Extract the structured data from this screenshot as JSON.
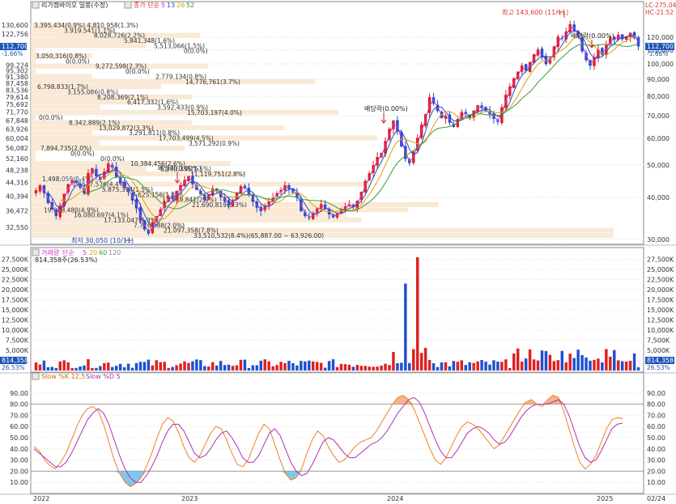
{
  "price_panel": {
    "legend_title": "리가켐바이오 일봉(수정)",
    "legend_ma_label": "종가 단순",
    "ma_periods": [
      "5",
      "13",
      "26",
      "52"
    ],
    "ma_colors": [
      "#cc33cc",
      "#1c50c8",
      "#e0a000",
      "#3a9a3a"
    ],
    "lc_label": "LC-275.04",
    "hc_label": "HC-21.52",
    "left_tag": "112,700",
    "left_tag_pct": "-1.66%",
    "right_tag": "112,700",
    "right_tag_pct": "-1.66%",
    "high_label": "최고 143,600 (11/11)",
    "low_label": "최저 30,050 (10/11)",
    "left_ticks": [
      "130,600",
      "122,756",
      "112,700",
      "99,224",
      "95,302",
      "91,380",
      "87,458",
      "83,536",
      "79,614",
      "75,692",
      "71,770",
      "67,848",
      "63,926",
      "60,004",
      "56,082",
      "52,160",
      "48,238",
      "44,316",
      "40,394",
      "36,472",
      "32,550"
    ],
    "right_ticks": [
      "120,000",
      "110,000",
      "100,000",
      "90,000",
      "80,000",
      "70,000",
      "60,000",
      "50,000",
      "40,000",
      "30,000"
    ],
    "dividend_labels": [
      "배당락(0.00%)",
      "배당락(0.00%)",
      "배당락(0.00%)"
    ],
    "volume_profile": [
      {
        "price": "3,395,434(0.9%)",
        "pct": "1.3%",
        "text": "3,395,434(0.9%) 4,810,958(1.3%)"
      },
      {
        "text": "3,919,541(1.1%)"
      },
      {
        "text": "8,028,726(2.2%)"
      },
      {
        "text": "5,841,348(1.6%)"
      },
      {
        "text": "5,513,066(1.5%)"
      },
      {
        "text": "0(0.0%)"
      },
      {
        "text": "3,050,316(0.8%)"
      },
      {
        "text": "0(0.0%)"
      },
      {
        "text": "9,272,598(2.3%)"
      },
      {
        "text": "0(0.0%)"
      },
      {
        "text": "2,779,134(0.8%)"
      },
      {
        "text": "14,776,761(3.7%)"
      },
      {
        "text": "6,798,833(1.7%)"
      },
      {
        "text": "3,155,086(0.8%)"
      },
      {
        "text": "8,208,369(2.1%)"
      },
      {
        "text": "6,417,332(1.6%)"
      },
      {
        "text": "3,592,433(0.9%)"
      },
      {
        "text": "15,703,197(4.0%)"
      },
      {
        "text": "0(0.0%)"
      },
      {
        "text": "8,342,889(2.1%)"
      },
      {
        "text": "13,029,872(3.3%)"
      },
      {
        "text": "3,291,811(0.8%)"
      },
      {
        "text": "17,703,499(4.5%)"
      },
      {
        "text": "3,571,292(0.9%)"
      },
      {
        "text": "7,894,735(2.0%)"
      },
      {
        "text": "0(0.0%)"
      },
      {
        "text": "0(0.0%)"
      },
      {
        "text": "10,384,456(2.6%)"
      },
      {
        "text": "5,989,395(1.5%)"
      },
      {
        "text": "11,119,751(2.8%)"
      },
      {
        "text": "1,498,059(0.4%)"
      },
      {
        "text": "17,527,576(4.4%)"
      },
      {
        "text": "5,875,394(1.5%)"
      },
      {
        "text": "7,625,156(1.8%)"
      },
      {
        "text": "11,639,841(2.9%)"
      },
      {
        "text": "21,690,819(5.3%)"
      },
      {
        "text": "19,088,480(4.9%)"
      },
      {
        "text": "16,080,697(4.1%)"
      },
      {
        "text": "17,133,047(4.3%)"
      },
      {
        "text": "7,776,388(2.0%)"
      },
      {
        "text": "21,097,358(7.8%)"
      },
      {
        "text": "33,510,532(8.4%)(65,887.00 ~ 63,926.00)"
      }
    ]
  },
  "volume_panel": {
    "legend_title": "거래량",
    "legend_ma_label": "단순",
    "ma_periods": [
      "5",
      "20",
      "60",
      "120"
    ],
    "current_value": "814,358주(26.53%)",
    "left_ticks": [
      "27,500K",
      "25,000K",
      "22,500K",
      "20,000K",
      "17,500K",
      "15,000K",
      "12,500K",
      "10,000K",
      "7,500K",
      "5,000K",
      "2,500K"
    ],
    "right_ticks": [
      "27,500K",
      "25,000K",
      "22,500K",
      "20,000K",
      "17,500K",
      "15,000K",
      "12,500K",
      "10,000K",
      "7,500K",
      "5,000K",
      "2,500K"
    ],
    "left_tag": "814,358",
    "left_tag_pct": "26.53%",
    "right_tag": "814,358",
    "right_tag_pct": "26.53%"
  },
  "stoch_panel": {
    "legend_k": "Slow %K 12,5",
    "legend_d": "Slow %D 5",
    "left_ticks": [
      "90.00",
      "80.00",
      "70.00",
      "60.00",
      "50.00",
      "40.00",
      "30.00",
      "20.00",
      "10.00"
    ],
    "right_ticks": [
      "90.00",
      "80.00",
      "70.00",
      "60.00",
      "50.00",
      "40.00",
      "30.00",
      "20.00",
      "10.00"
    ]
  },
  "x_axis": {
    "labels": [
      "2022",
      "2023",
      "2024",
      "2025"
    ],
    "end_label": "02/24"
  },
  "chart_data": {
    "type": "candlestick",
    "title": "리가켐바이오 일봉(수정)",
    "x_range": [
      "2022-01",
      "2025-02-24"
    ],
    "price_scale": "log",
    "y_range": [
      29000,
      140000
    ],
    "high": {
      "value": 143600,
      "date": "11/11",
      "year": 2024
    },
    "low": {
      "value": 30050,
      "date": "10/11",
      "year": 2022
    },
    "last_close": 112700,
    "last_change_pct": -1.66,
    "weekly_close": [
      42000,
      43500,
      41200,
      38500,
      36800,
      35200,
      37900,
      41000,
      43800,
      44900,
      44200,
      42800,
      41100,
      47300,
      48900,
      46200,
      45100,
      47800,
      50500,
      49200,
      46100,
      44200,
      42800,
      41500,
      39200,
      37100,
      34200,
      32100,
      31200,
      33800,
      35200,
      36900,
      38800,
      40200,
      39600,
      41800,
      43500,
      45100,
      46300,
      43800,
      42100,
      40900,
      39200,
      40800,
      42600,
      41900,
      40100,
      38900,
      37800,
      39200,
      41400,
      43200,
      42700,
      40900,
      38800,
      37300,
      36400,
      37800,
      38900,
      39900,
      41200,
      42100,
      43500,
      42400,
      41300,
      39800,
      36400,
      35200,
      34800,
      35900,
      37100,
      38200,
      37000,
      35600,
      34900,
      35800,
      36900,
      37600,
      38100,
      37400,
      39100,
      41600,
      44800,
      47200,
      49900,
      52800,
      54300,
      58900,
      64100,
      67800,
      62900,
      56700,
      52100,
      50600,
      54800,
      60200,
      65900,
      70800,
      79600,
      76200,
      72400,
      68900,
      70200,
      66800,
      64900,
      68500,
      71800,
      70900,
      69100,
      72600,
      75300,
      73800,
      71900,
      70800,
      68600,
      67200,
      74300,
      80900,
      85600,
      90500,
      94800,
      98900,
      95400,
      101200,
      106800,
      110300,
      104500,
      99800,
      103900,
      112600,
      120500,
      118900,
      124800,
      131200,
      125300,
      119800,
      108900,
      102600,
      98700,
      104800,
      110500,
      106400,
      113800,
      119700,
      117900,
      122100,
      118400,
      120900,
      123900,
      119200,
      112700
    ],
    "volume_series": {
      "unit": "shares (K)",
      "notable_peaks": [
        {
          "period": "2024-01",
          "value": 21500
        },
        {
          "period": "2024-02",
          "value": 28000
        }
      ],
      "last": 814.358
    },
    "stochastic": {
      "k_period": "12,5",
      "d_period": "5",
      "k": [
        42,
        38,
        30,
        25,
        22,
        28,
        36,
        48,
        60,
        70,
        76,
        78,
        74,
        62,
        46,
        30,
        18,
        10,
        6,
        9,
        14,
        24,
        36,
        50,
        62,
        68,
        65,
        55,
        42,
        32,
        28,
        34,
        44,
        54,
        60,
        58,
        48,
        36,
        26,
        24,
        30,
        42,
        54,
        62,
        58,
        44,
        30,
        18,
        12,
        14,
        22,
        36,
        48,
        56,
        52,
        42,
        34,
        28,
        30,
        36,
        42,
        46,
        48,
        50,
        56,
        64,
        72,
        80,
        86,
        88,
        84,
        76,
        64,
        52,
        40,
        30,
        26,
        32,
        42,
        52,
        60,
        64,
        62,
        58,
        52,
        46,
        40,
        44,
        52,
        60,
        68,
        76,
        82,
        84,
        80,
        78,
        84,
        88,
        86,
        74,
        58,
        42,
        28,
        22,
        26,
        34,
        46,
        58,
        66,
        68,
        67
      ],
      "d": [
        40,
        36,
        32,
        28,
        24,
        24,
        28,
        36,
        46,
        56,
        66,
        72,
        76,
        72,
        62,
        48,
        34,
        22,
        14,
        10,
        10,
        16,
        24,
        34,
        46,
        56,
        62,
        62,
        56,
        46,
        36,
        32,
        34,
        40,
        48,
        54,
        56,
        50,
        42,
        32,
        28,
        28,
        34,
        44,
        54,
        58,
        52,
        40,
        28,
        20,
        16,
        18,
        26,
        36,
        46,
        50,
        48,
        42,
        36,
        32,
        32,
        36,
        40,
        44,
        46,
        50,
        56,
        64,
        72,
        78,
        84,
        86,
        82,
        72,
        60,
        48,
        38,
        32,
        32,
        38,
        46,
        54,
        58,
        60,
        58,
        54,
        48,
        44,
        46,
        52,
        60,
        68,
        74,
        78,
        80,
        80,
        80,
        82,
        84,
        80,
        70,
        56,
        42,
        32,
        28,
        30,
        38,
        48,
        58,
        62,
        63
      ],
      "ylim": [
        0,
        100
      ]
    }
  }
}
